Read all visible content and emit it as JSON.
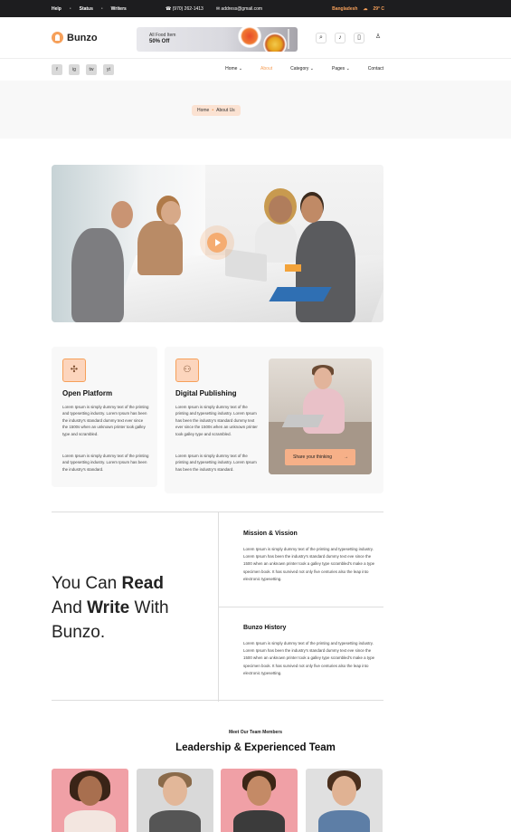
{
  "topbar": {
    "links": [
      "Help",
      "Status",
      "Writers"
    ],
    "phone": "(970) 262-1413",
    "email": "address@gmail.com",
    "location": "Bangladesh",
    "temperature": "29° C"
  },
  "header": {
    "logo_text": "Bunzo",
    "promo_line1": "All Food Item",
    "promo_line2": "50% Off",
    "icons": [
      "search-icon",
      "bell-icon",
      "bookmark-icon",
      "user-icon"
    ]
  },
  "nav": {
    "socials": [
      "f",
      "ig",
      "tw",
      "yt"
    ],
    "menu": [
      {
        "label": "Home ⌄",
        "active": false
      },
      {
        "label": "About",
        "active": true
      },
      {
        "label": "Category ⌄",
        "active": false
      },
      {
        "label": "Pages ⌄",
        "active": false
      },
      {
        "label": "Contact",
        "active": false
      }
    ]
  },
  "breadcrumb": {
    "home": "Home",
    "current": "About Us"
  },
  "features": [
    {
      "title": "Open Platform",
      "p1": "Lorem Ipsum is simply dummy text of the printing and typesetting industry. Lorem Ipsum has been the industry's standard dummy text ever since the 1500s when an unknown printer took galley type and scrambled.",
      "p2": "Lorem Ipsum is simply dummy text of the printing and typesetting industry. Lorem Ipsum has been the industry's standard."
    },
    {
      "title": "Digital Publishing",
      "p1": "Lorem Ipsum is simply dummy text of the printing and typesetting industry. Lorem Ipsum has been the industry's standard dummy text ever since the 1500s when an unknown printer took galley type and scrambled.",
      "p2": "Lorem Ipsum is simply dummy text of the printing and typesetting industry. Lorem Ipsum has been the industry's standard."
    }
  ],
  "share_button": "Share your thinking",
  "tagline": {
    "l1a": "You Can ",
    "l1b": "Read",
    "l2a": "And ",
    "l2b": "Write",
    "l2c": " With",
    "l3": "Bunzo."
  },
  "mission": {
    "title": "Mission & Vission",
    "text": "Lorem Ipsum is simply dummy text of the printing and typesetting industry. Lorem Ipsum has been the industry's standard dummy text eve since the 1500 when an unknown printer took a galley type scrambled's make a type specimen book. It has survived not only five centuries also the leap into electronic typesetting."
  },
  "history": {
    "title": "Bunzo History",
    "text": "Lorem Ipsum is simply dummy text of the printing and typesetting industry. Lorem Ipsum has been the industry's standard dummy text eve since the 1500 when an unknown printer took a galley type scrambled's make a type specimen book. It has survived not only five centuries also the leap into electronic typesetting."
  },
  "team": {
    "subtitle": "Meet Our Team Members",
    "title": "Leadership & Experienced Team"
  },
  "colors": {
    "accent": "#f6a05a",
    "accent_light": "#fcd5bd",
    "dark": "#1d1d1f"
  }
}
